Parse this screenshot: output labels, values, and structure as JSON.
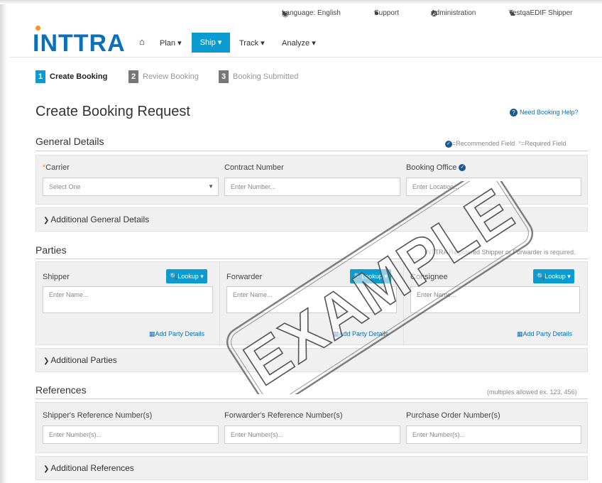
{
  "header": {
    "language": "Language: English",
    "support": "Support",
    "administration": "Administration",
    "user": "TestqaEDIF Shipper",
    "logo": "INTTRA",
    "nav": {
      "plan": "Plan",
      "ship": "Ship",
      "track": "Track",
      "analyze": "Analyze"
    }
  },
  "steps": [
    {
      "num": "1",
      "label": "Create Booking"
    },
    {
      "num": "2",
      "label": "Review Booking"
    },
    {
      "num": "3",
      "label": "Booking Submitted"
    }
  ],
  "page": {
    "title": "Create Booking Request",
    "help": "Need Booking Help?"
  },
  "general": {
    "title": "General Details",
    "legend_recommended": "=Recommended Field",
    "legend_required": "=Required Field",
    "carrier_label": "Carrier",
    "carrier_select": "Select One",
    "contract_label": "Contract Number",
    "contract_placeholder": "Enter Number...",
    "office_label": "Booking Office",
    "office_placeholder": "Enter Location...",
    "additional": "Additional General Details"
  },
  "parties": {
    "title": "Parties",
    "note": "INTTRA Registered Shipper or Forwarder is required.",
    "shipper_label": "Shipper",
    "forwarder_label": "Forwarder",
    "consignee_label": "Consignee",
    "lookup": "Lookup",
    "name_placeholder": "Enter Name...",
    "add_party": "Add Party Details",
    "additional": "Additional Parties"
  },
  "references": {
    "title": "References",
    "note": "(multiples allowed ex. 123, 456)",
    "shipper_ref_label": "Shipper's Reference Number(s)",
    "forwarder_ref_label": "Forwarder's Reference Number(s)",
    "po_label": "Purchase Order Number(s)",
    "number_placeholder": "Enter Number(s)...",
    "additional": "Additional References"
  },
  "watermark": "EXAMPLE",
  "colors": {
    "brand": "#0a70b7",
    "accent": "#0a9bd1",
    "required": "#f7931e"
  }
}
